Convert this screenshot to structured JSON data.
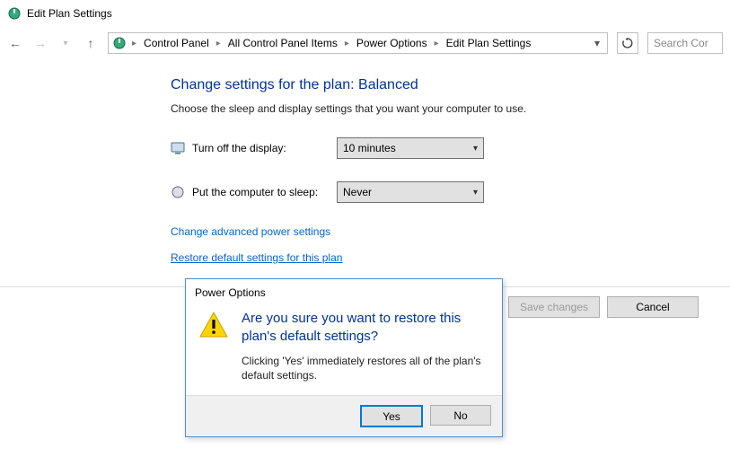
{
  "window": {
    "title": "Edit Plan Settings"
  },
  "breadcrumb": {
    "items": [
      "Control Panel",
      "All Control Panel Items",
      "Power Options",
      "Edit Plan Settings"
    ]
  },
  "search": {
    "placeholder": "Search Cor"
  },
  "page": {
    "title": "Change settings for the plan: Balanced",
    "subtitle": "Choose the sleep and display settings that you want your computer to use."
  },
  "settings": {
    "display_label": "Turn off the display:",
    "display_value": "10 minutes",
    "sleep_label": "Put the computer to sleep:",
    "sleep_value": "Never"
  },
  "links": {
    "advanced": "Change advanced power settings",
    "restore": "Restore default settings for this plan"
  },
  "actions": {
    "save": "Save changes",
    "cancel": "Cancel"
  },
  "dialog": {
    "title": "Power Options",
    "heading": "Are you sure you want to restore this plan's default settings?",
    "body": "Clicking 'Yes' immediately restores all of the plan's default settings.",
    "yes": "Yes",
    "no": "No"
  }
}
